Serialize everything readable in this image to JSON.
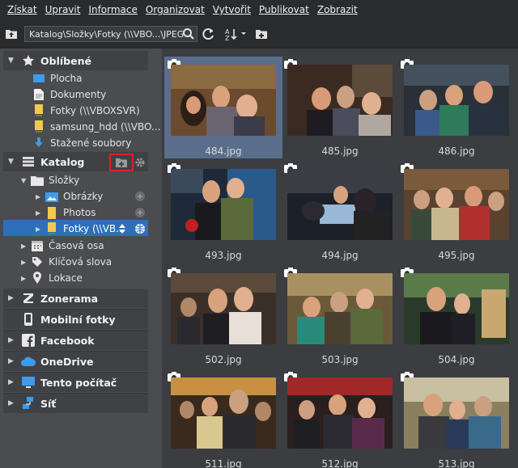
{
  "menu": [
    "Získat",
    "Upravit",
    "Informace",
    "Organizovat",
    "Vytvořit",
    "Publikovat",
    "Zobrazit"
  ],
  "menu_underline_index": [
    0,
    0,
    0,
    0,
    1,
    0,
    1
  ],
  "toolbar": {
    "path": "Katalog\\Složky\\Fotky (\\\\VBO...\\JPEG"
  },
  "sidebar": {
    "favorites": {
      "title": "Oblíbené",
      "items": [
        "Plocha",
        "Dokumenty",
        "Fotky (\\\\VBOXSVR)",
        "samsung_hdd (\\\\VBO...",
        "Stažené soubory"
      ]
    },
    "catalog": {
      "title": "Katalog",
      "folders": "Složky",
      "sub": [
        "Obrázky",
        "Photos",
        "Fotky (\\\\VB..."
      ],
      "other": [
        "Časová osa",
        "Klíčová slova",
        "Lokace"
      ]
    },
    "sections": [
      "Zonerama",
      "Mobilní fotky",
      "Facebook",
      "OneDrive",
      "Tento počítač",
      "Síť"
    ]
  },
  "thumbnails": [
    "484.jpg",
    "485.jpg",
    "486.jpg",
    "493.jpg",
    "494.jpg",
    "495.jpg",
    "502.jpg",
    "503.jpg",
    "504.jpg",
    "511.jpg",
    "512.jpg",
    "513.jpg"
  ],
  "selected_thumbnail": "484.jpg",
  "colors": {
    "accent": "#2f6fba",
    "highlight_box": "#e02020",
    "selected_thumb": "#5a6e8c"
  }
}
